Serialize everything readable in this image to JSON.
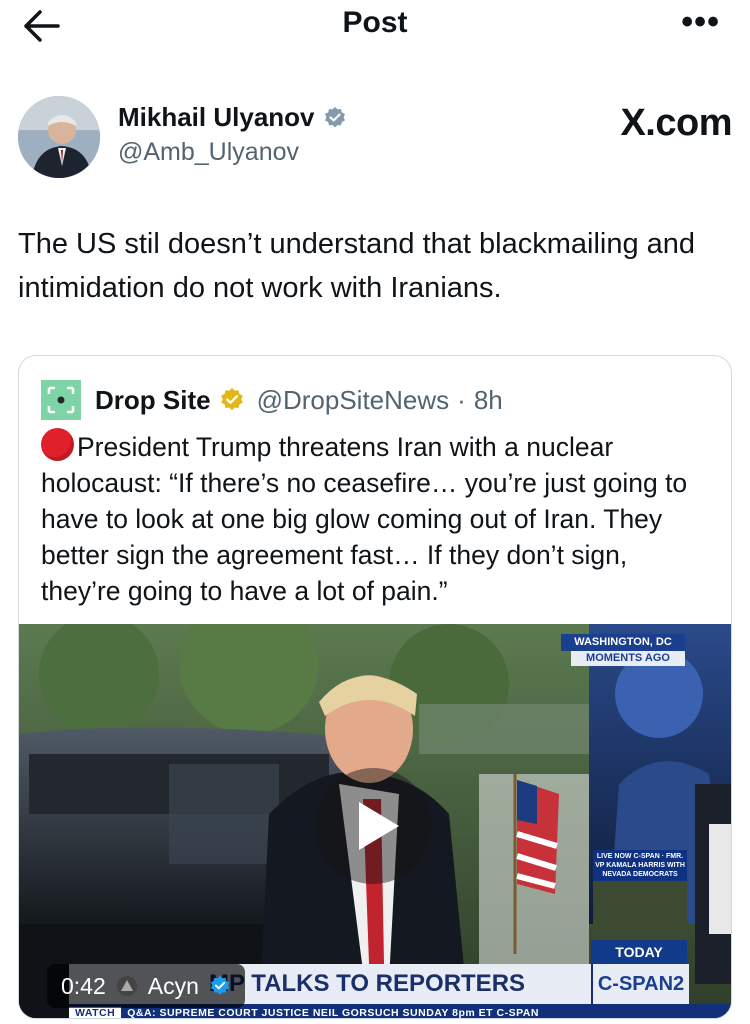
{
  "header": {
    "title": "Post"
  },
  "author": {
    "name": "Mikhail Ulyanov",
    "handle": "@Amb_Ulyanov",
    "site": "X.com",
    "verified_color": "#829aab"
  },
  "post": {
    "text": "The US stil doesn’t understand that  blackmailing and intimidation do not work with Iranians."
  },
  "quote": {
    "name": "Drop Site",
    "handle": "@DropSiteNews",
    "separator": "·",
    "time": "8h",
    "verified_color": "#e2b719",
    "text": "President Trump threatens Iran with a nuclear holocaust: “If there’s no ceasefire… you’re just going to have to look at one big glow coming out of Iran. They better sign the agreement fast… If they don’t sign, they’re going to have a lot of pain.”"
  },
  "video": {
    "duration": "0:42",
    "source": "Acyn",
    "banner": "MP TALKS TO REPORTERS",
    "banner_prefix": "PRES. TRU",
    "channel": "C-SPAN2",
    "today": "TODAY",
    "location": "WASHINGTON, DC",
    "moments": "MOMENTS AGO",
    "ticker_label": "WATCH",
    "ticker": "Q&A: SUPREME COURT JUSTICE NEIL GORSUCH  SUNDAY 8pm ET  C-SPAN",
    "live_bug": "LIVE NOW C-SPAN · FMR. VP KAMALA HARRIS WITH NEVADA DEMOCRATS"
  },
  "icons": [
    "back-arrow-icon",
    "more-icon",
    "verified-badge-icon",
    "play-icon",
    "dropsite-logo-icon"
  ]
}
